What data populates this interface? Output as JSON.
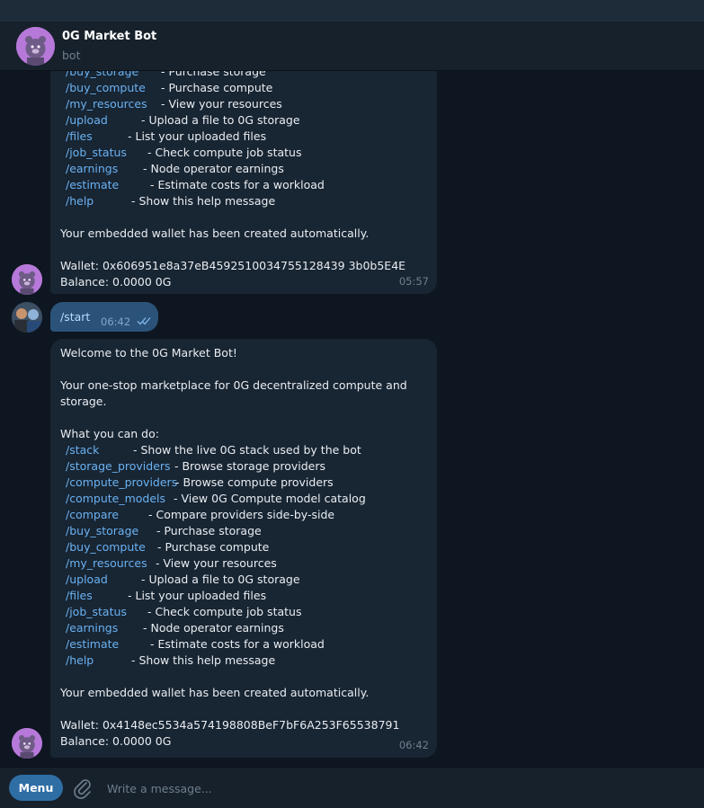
{
  "header": {
    "title": "0G Market Bot",
    "subtitle": "bot"
  },
  "messages": {
    "first": {
      "partial_line": {
        "cmd": "/buy_storage",
        "desc": "- Purchase storage"
      },
      "commands": [
        {
          "cmd": "/buy_compute",
          "desc": "- Purchase compute"
        },
        {
          "cmd": "/my_resources",
          "desc": "- View your resources"
        },
        {
          "cmd": "/upload",
          "desc": "- Upload a file to 0G storage"
        },
        {
          "cmd": "/files",
          "desc": "- List your uploaded files"
        },
        {
          "cmd": "/job_status",
          "desc": "- Check compute job status"
        },
        {
          "cmd": "/earnings",
          "desc": "- Node operator earnings"
        },
        {
          "cmd": "/estimate",
          "desc": "- Estimate costs for a workload"
        },
        {
          "cmd": "/help",
          "desc": "- Show this help message"
        }
      ],
      "wallet_note": "Your embedded wallet has been created automatically.",
      "wallet": "Wallet: 0x606951e8a37eB4592510034755128439 3b0b5E4E",
      "balance": "Balance: 0.0000 0G",
      "time": "05:57"
    },
    "user": {
      "text": "/start",
      "time": "06:42"
    },
    "second": {
      "welcome": "Welcome to the 0G Market Bot!",
      "intro_line1": "Your one-stop marketplace for 0G decentralized compute and",
      "intro_line2": "storage.",
      "what_you_can_do": "What you can do:",
      "commands": [
        {
          "cmd": "/stack",
          "desc": "- Show the live 0G stack used by the bot"
        },
        {
          "cmd": "/storage_providers",
          "desc": "- Browse storage providers"
        },
        {
          "cmd": "/compute_providers",
          "desc": "- Browse compute providers"
        },
        {
          "cmd": "/compute_models",
          "desc": "- View 0G Compute model catalog"
        },
        {
          "cmd": "/compare",
          "desc": "- Compare providers side-by-side"
        },
        {
          "cmd": "/buy_storage",
          "desc": "- Purchase storage"
        },
        {
          "cmd": "/buy_compute",
          "desc": "- Purchase compute"
        },
        {
          "cmd": "/my_resources",
          "desc": "- View your resources"
        },
        {
          "cmd": "/upload",
          "desc": "- Upload a file to 0G storage"
        },
        {
          "cmd": "/files",
          "desc": "- List your uploaded files"
        },
        {
          "cmd": "/job_status",
          "desc": "- Check compute job status"
        },
        {
          "cmd": "/earnings",
          "desc": "- Node operator earnings"
        },
        {
          "cmd": "/estimate",
          "desc": "- Estimate costs for a workload"
        },
        {
          "cmd": "/help",
          "desc": "- Show this help message"
        }
      ],
      "wallet_note": "Your embedded wallet has been created automatically.",
      "wallet": "Wallet: 0x4148ec5534a574198808BeF7bF6A253F65538791",
      "balance": "Balance: 0.0000 0G",
      "time": "06:42"
    }
  },
  "input": {
    "menu_label": "Menu",
    "placeholder": "Write a message..."
  },
  "icons": {
    "attach": "paperclip-icon",
    "read": "double-check-icon"
  },
  "colors": {
    "accent": "#6ab2f2",
    "outgoing": "#2b5278",
    "incoming": "#182533",
    "menu": "#2f6ea5"
  }
}
